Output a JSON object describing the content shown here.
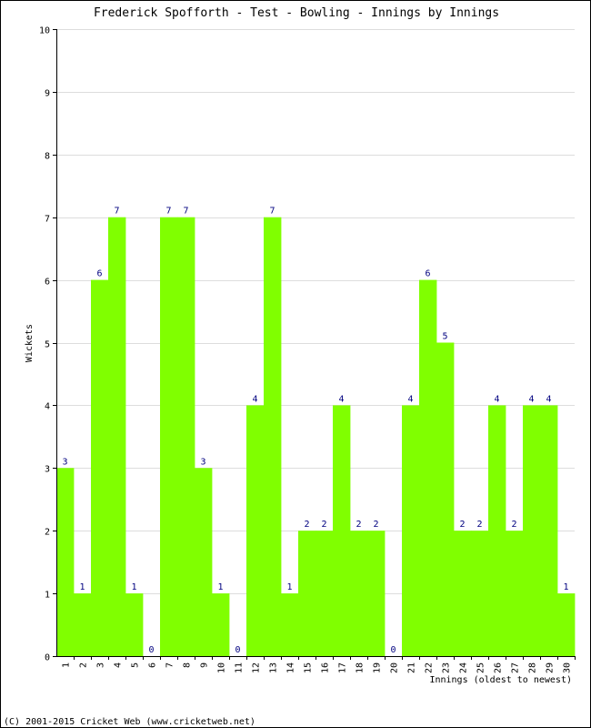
{
  "chart_data": {
    "type": "bar",
    "title": "Frederick Spofforth - Test - Bowling - Innings by Innings",
    "xlabel": "Innings (oldest to newest)",
    "ylabel": "Wickets",
    "ylim": [
      0,
      10
    ],
    "yticks": [
      0,
      1,
      2,
      3,
      4,
      5,
      6,
      7,
      8,
      9,
      10
    ],
    "grid": true,
    "categories": [
      "1",
      "2",
      "3",
      "4",
      "5",
      "6",
      "7",
      "8",
      "9",
      "10",
      "11",
      "12",
      "13",
      "14",
      "15",
      "16",
      "17",
      "18",
      "19",
      "20",
      "21",
      "22",
      "23",
      "24",
      "25",
      "26",
      "27",
      "28",
      "29",
      "30"
    ],
    "values": [
      3,
      1,
      6,
      7,
      1,
      0,
      7,
      7,
      3,
      1,
      0,
      4,
      7,
      1,
      2,
      2,
      4,
      2,
      2,
      0,
      4,
      6,
      5,
      2,
      2,
      4,
      2,
      4,
      4,
      1
    ],
    "bar_color": "#80ff00",
    "label_color": "#000080"
  },
  "footer": "(C) 2001-2015 Cricket Web (www.cricketweb.net)"
}
